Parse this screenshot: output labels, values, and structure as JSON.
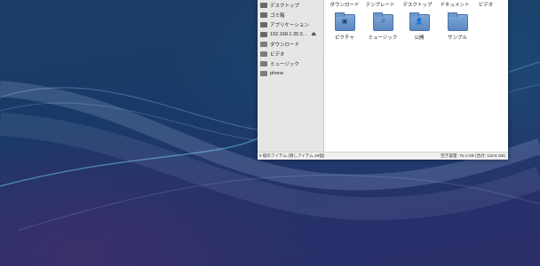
{
  "sidebar": {
    "items": [
      {
        "label": "デスクトップ",
        "icon": "desktop-icon"
      },
      {
        "label": "ゴミ箱",
        "icon": "trash-icon"
      },
      {
        "label": "アプリケーション",
        "icon": "applications-icon"
      },
      {
        "label": "192.168.1.35:3…",
        "icon": "network-drive-icon",
        "eject": "⏏"
      },
      {
        "label": "ダウンロード",
        "icon": "folder-icon"
      },
      {
        "label": "ビデオ",
        "icon": "folder-icon"
      },
      {
        "label": "ミュージック",
        "icon": "folder-icon"
      },
      {
        "label": "phone",
        "icon": "folder-icon"
      }
    ]
  },
  "top_names": [
    "ダウンロード",
    "テンプレート",
    "デスクトップ",
    "ドキュメント",
    "ビデオ"
  ],
  "folders": [
    {
      "label": "ピクチャ",
      "icon": "pictures-folder-icon",
      "emblem": "▣"
    },
    {
      "label": "ミュージック",
      "icon": "music-folder-icon",
      "emblem": "♫"
    },
    {
      "label": "公開",
      "icon": "public-folder-icon",
      "emblem": "👤"
    },
    {
      "label": "サンプル",
      "icon": "folder-icon",
      "emblem": ""
    }
  ],
  "status": {
    "left": "9 個のアイテム (隠しアイテム 26個)",
    "right": "空き容量: 75.4 GB (合計: 119.8 GB)"
  },
  "colors": {
    "folder": "#6d98cc",
    "desktop_bg": "#1b3d66"
  }
}
